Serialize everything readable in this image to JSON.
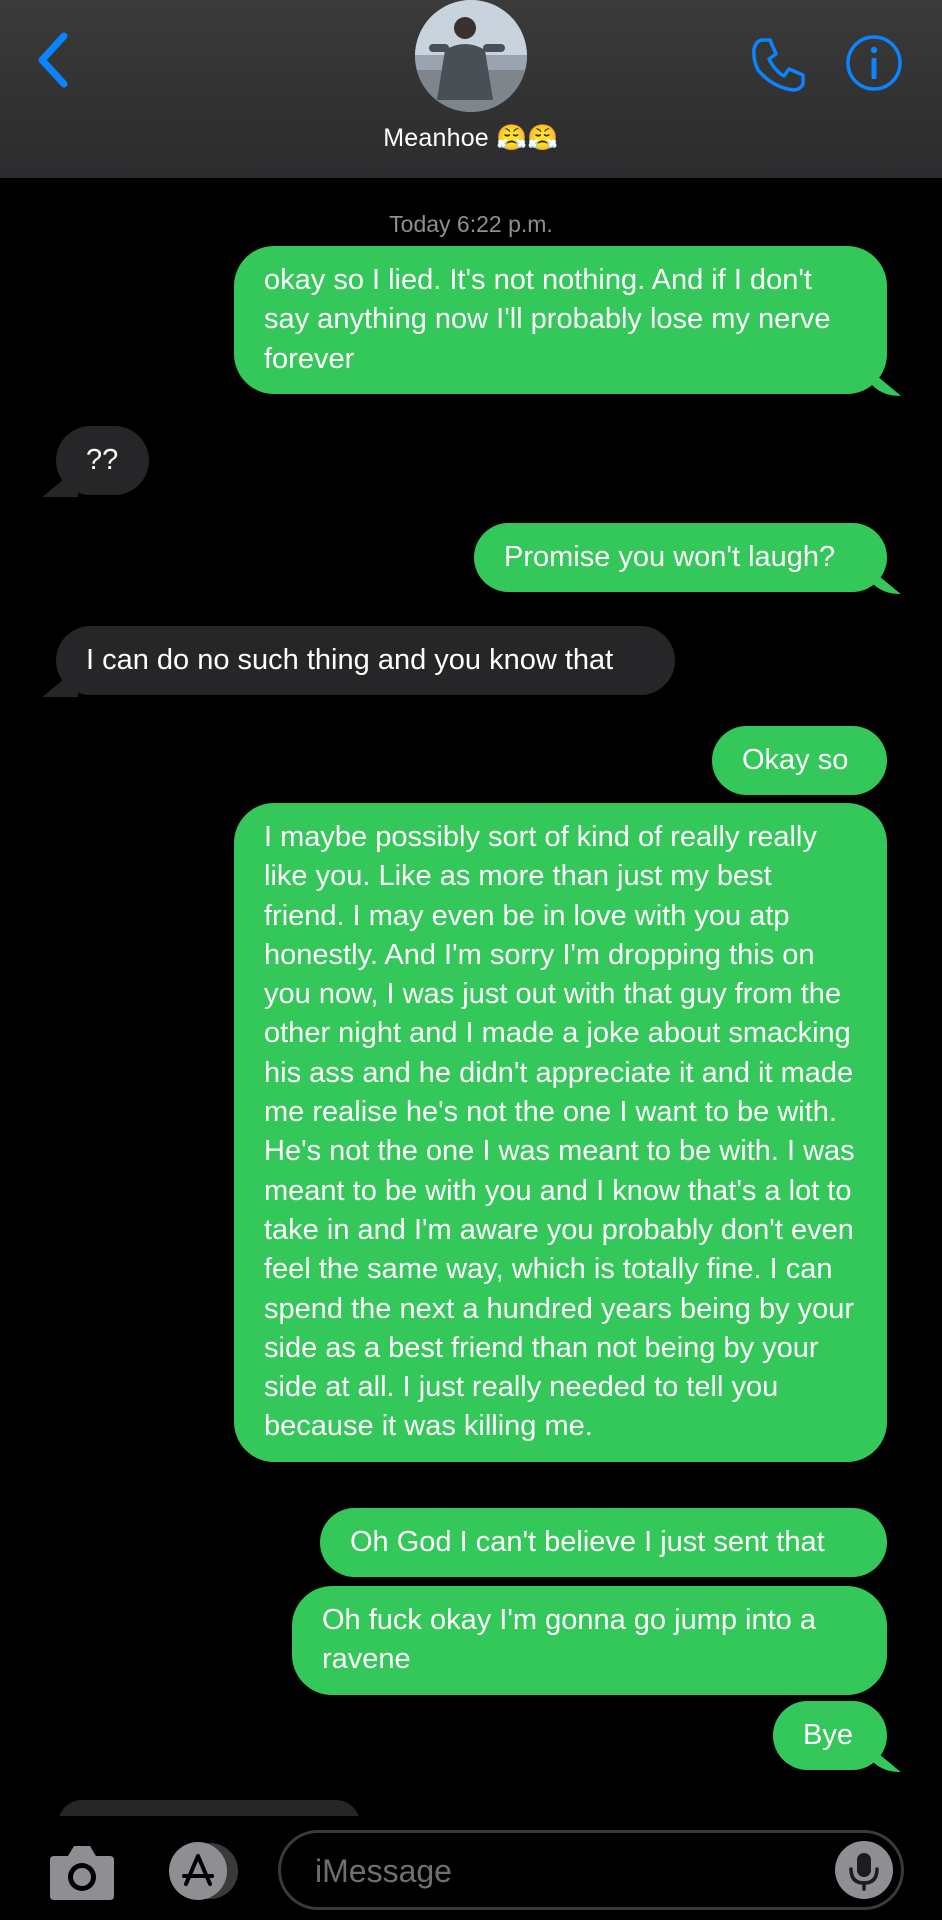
{
  "header": {
    "contact_name": "Meanhoe 😤😤",
    "icons": [
      "back-chevron-icon",
      "avatar",
      "phone-icon",
      "info-icon"
    ]
  },
  "conversation": {
    "timestamp": "Today 6:22 p.m.",
    "messages": [
      {
        "from": "me",
        "text": "okay so I lied. It's not nothing. And if I don't say anything now I'll probably lose my nerve forever"
      },
      {
        "from": "them",
        "text": "??"
      },
      {
        "from": "me",
        "text": "Promise you won't laugh?"
      },
      {
        "from": "them",
        "text": "I can do no such thing and you know that"
      },
      {
        "from": "me",
        "text": "Okay so"
      },
      {
        "from": "me",
        "text": "I maybe possibly sort of kind of really really like you. Like as more than just my best friend. I may even be in love with you atp honestly. And I'm sorry I'm dropping this on you now, I was just out with that guy from the other night and I made a joke about smacking his ass and he didn't appreciate it and it made me realise he's not the one I want to be with. He's not the one I was meant to be with. I was meant to be with you and I know that's a lot to take in and I'm aware you probably don't even feel the same way, which is totally fine. I can spend the next a hundred years being by your side as a best friend than not being by your side at all. I just really needed to tell you because it was killing me."
      },
      {
        "from": "me",
        "text": "Oh God I can't believe I just sent that"
      },
      {
        "from": "me",
        "text": "Oh fuck okay I'm gonna go jump into a ravene"
      },
      {
        "from": "me",
        "text": "Bye"
      }
    ]
  },
  "composer": {
    "placeholder": "iMessage",
    "icons": [
      "camera-icon",
      "app-store-icon",
      "microphone-icon"
    ]
  },
  "colors": {
    "outgoing_bubble": "#34c759",
    "incoming_bubble": "#262628",
    "accent": "#0a84ff",
    "background": "#000000"
  }
}
